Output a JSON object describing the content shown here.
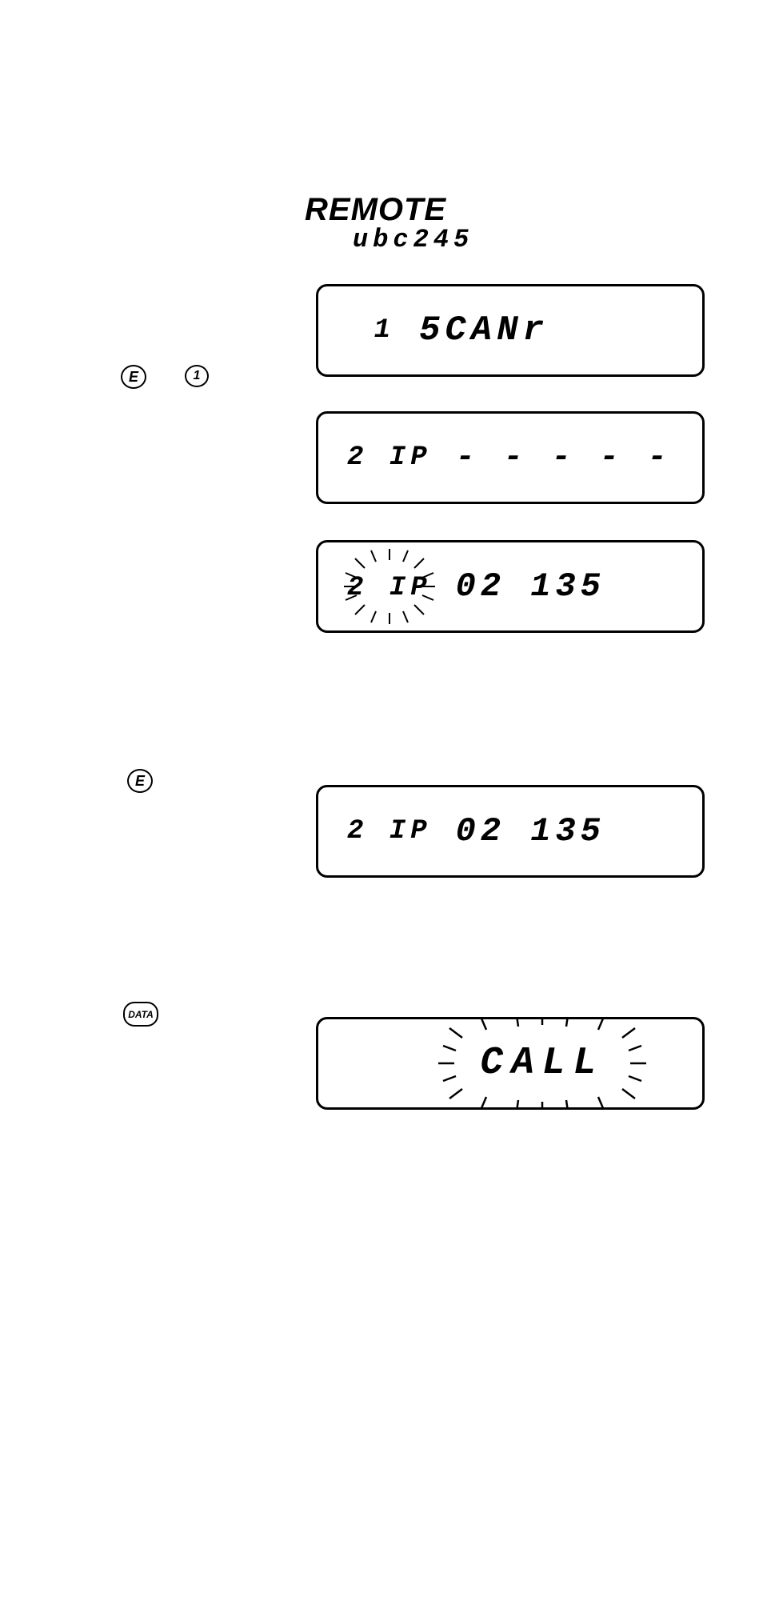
{
  "title": {
    "main": "REMOTE",
    "sub": "ubc245"
  },
  "buttons": {
    "e1": "E",
    "one": "1",
    "e2": "E",
    "data": "DATA"
  },
  "screens": {
    "s1": {
      "left": "1",
      "right": "5CANr"
    },
    "s2": {
      "left": "2 IP",
      "right": "- - - - -"
    },
    "s3": {
      "left": "2 IP",
      "right": "02 135"
    },
    "s4": {
      "left": "2 IP",
      "right": "02 135"
    },
    "s5": {
      "center": "CALL"
    }
  }
}
